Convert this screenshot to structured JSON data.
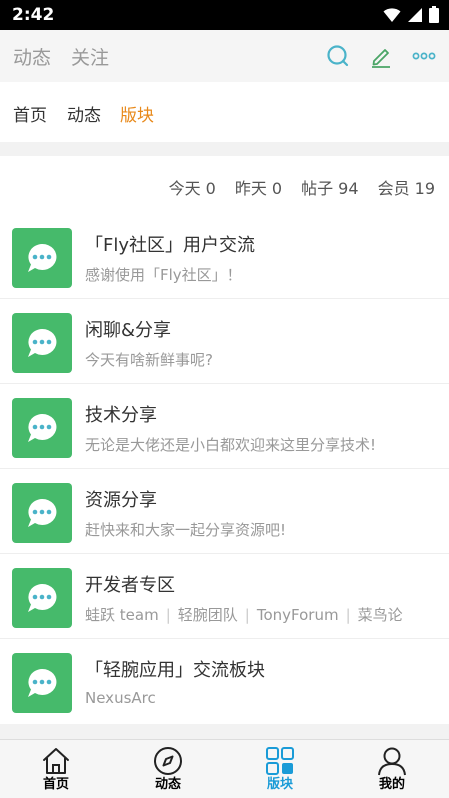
{
  "status_bar": {
    "time": "2:42"
  },
  "header": {
    "tabs": [
      {
        "label": "动态"
      },
      {
        "label": "关注"
      }
    ],
    "icons": [
      "search-icon",
      "edit-icon",
      "more-icon"
    ]
  },
  "sub_nav": {
    "items": [
      {
        "label": "首页",
        "active": false
      },
      {
        "label": "动态",
        "active": false
      },
      {
        "label": "版块",
        "active": true
      }
    ]
  },
  "stats": {
    "today_label": "今天",
    "today": "0",
    "yesterday_label": "昨天",
    "yesterday": "0",
    "posts_label": "帖子",
    "posts": "94",
    "members_label": "会员",
    "members": "19"
  },
  "forums": [
    {
      "title": "「Fly社区」用户交流",
      "desc": "感谢使用「Fly社区」！"
    },
    {
      "title": "闲聊&分享",
      "desc": "今天有啥新鲜事呢?"
    },
    {
      "title": "技术分享",
      "desc": "无论是大佬还是小白都欢迎来这里分享技术!"
    },
    {
      "title": "资源分享",
      "desc": "赶快来和大家一起分享资源吧!"
    },
    {
      "title": "开发者专区",
      "moderators": [
        "蛙跃 team",
        "轻腕团队",
        "TonyForum",
        "菜鸟论"
      ]
    },
    {
      "title": "「轻腕应用」交流板块",
      "desc": "NexusArc"
    }
  ],
  "bottom_nav": [
    {
      "label": "首页",
      "icon": "home-icon"
    },
    {
      "label": "动态",
      "icon": "compass-icon"
    },
    {
      "label": "版块",
      "icon": "grid-icon",
      "active": true
    },
    {
      "label": "我的",
      "icon": "user-icon"
    }
  ],
  "colors": {
    "accent_orange": "#e8891a",
    "forum_green": "#46ba6b",
    "active_blue": "#1a9bd7",
    "icon_teal": "#4ab3c9"
  }
}
